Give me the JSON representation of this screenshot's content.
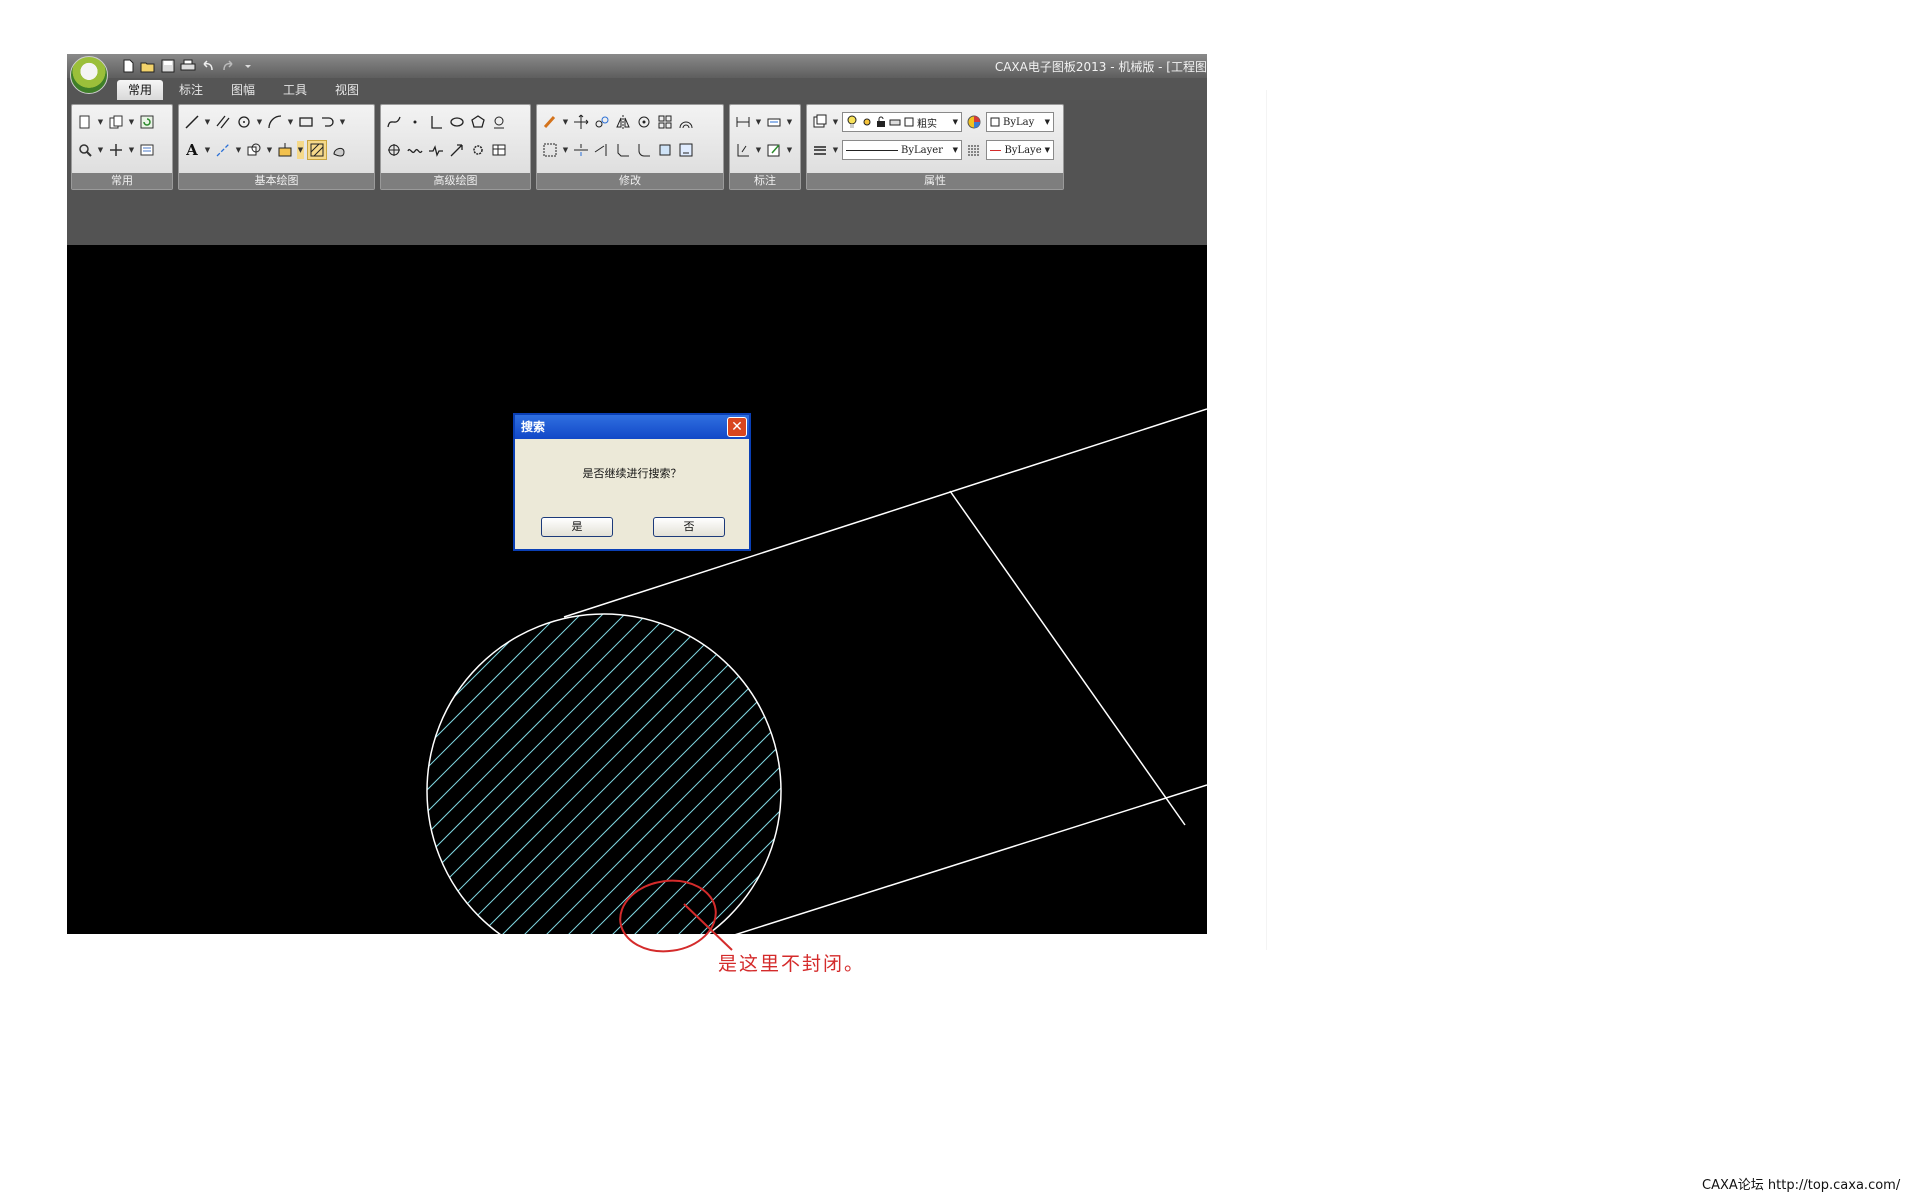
{
  "window": {
    "title": "CAXA电子图板2013 - 机械版 - [工程图",
    "tabs": [
      {
        "label": "常用",
        "active": true
      },
      {
        "label": "标注",
        "active": false
      },
      {
        "label": "图幅",
        "active": false
      },
      {
        "label": "工具",
        "active": false
      },
      {
        "label": "视图",
        "active": false
      }
    ]
  },
  "ribbon": {
    "groups": [
      "常用",
      "基本绘图",
      "高级绘图",
      "修改",
      "标注",
      "属性"
    ],
    "properties": {
      "layer_state": "粗实",
      "color_combo": "ByLay",
      "linetype_combo": "ByLayer",
      "lineweight_combo": "ByLaye"
    }
  },
  "dialog": {
    "title": "搜索",
    "message": "是否继续进行搜索？",
    "yes_label": "是",
    "no_label": "否",
    "close_glyph": "✕"
  },
  "annotation": {
    "text": "是这里不封闭。",
    "color": "#d42b2b"
  },
  "footer": {
    "text": "CAXA论坛 http://top.caxa.com/"
  },
  "colors": {
    "canvas_bg": "#000000",
    "geometry": "#ffffff",
    "hatch": "#7fd6e0",
    "dialog_title": "#1248c7"
  }
}
